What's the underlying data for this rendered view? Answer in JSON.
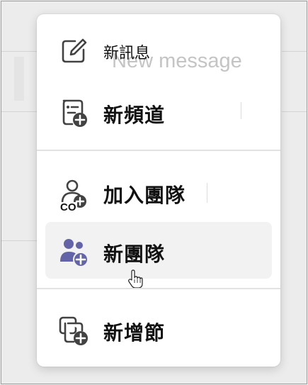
{
  "menu": {
    "items": [
      {
        "label": "新訊息",
        "icon": "compose-icon"
      },
      {
        "label": "新頻道",
        "icon": "new-channel-icon"
      },
      {
        "label": "加入團隊",
        "icon": "join-team-icon"
      },
      {
        "label": "新團隊",
        "icon": "new-team-icon"
      },
      {
        "label": "新增節",
        "icon": "new-section-icon"
      }
    ],
    "background_label": "New message",
    "join_badge": "CO"
  },
  "colors": {
    "accent": "#6264a7",
    "icon": "#424242",
    "hover": "#f2f2f2"
  }
}
